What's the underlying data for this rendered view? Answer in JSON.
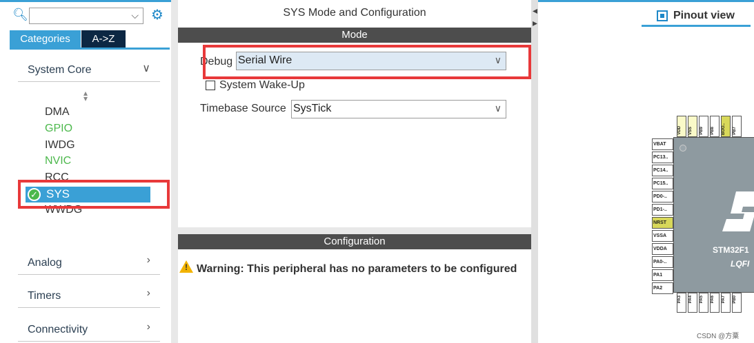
{
  "left": {
    "search_placeholder": "",
    "tabs": {
      "categories": "Categories",
      "az": "A->Z"
    },
    "groups": {
      "system_core": "System Core",
      "analog": "Analog",
      "timers": "Timers",
      "connectivity": "Connectivity"
    },
    "system_core_items": [
      "DMA",
      "GPIO",
      "IWDG",
      "NVIC",
      "RCC",
      "SYS",
      "WWDG"
    ]
  },
  "mid": {
    "title": "SYS Mode and Configuration",
    "mode_header": "Mode",
    "debug_label": "Debug",
    "debug_value": "Serial Wire",
    "wakeup_label": "System Wake-Up",
    "timebase_label": "Timebase Source",
    "timebase_value": "SysTick",
    "config_header": "Configuration",
    "warning": "Warning: This peripheral has no parameters to be configured"
  },
  "right": {
    "pinout_tab": "Pinout view",
    "chip_name": "STM32F1",
    "chip_package": "LQFI",
    "left_pins": [
      "VBAT",
      "PC13..",
      "PC14..",
      "PC15..",
      "PD0-..",
      "PD1-..",
      "NRST",
      "VSSA",
      "VDDA",
      "PA0-..",
      "PA1",
      "PA2"
    ],
    "top_pins": [
      "VDD",
      "VSS",
      "PB9",
      "PB8",
      "BOO..",
      "PB7"
    ],
    "bottom_pins": [
      "PA3",
      "PA4",
      "PA5",
      "PA6",
      "PA7",
      "PB0"
    ],
    "watermark": "CSDN @方粟"
  },
  "colors": {
    "accent": "#3aa0d6",
    "dark_tab": "#0c2743",
    "highlight_red": "#e8393a",
    "green_ok": "#4cb84c"
  }
}
